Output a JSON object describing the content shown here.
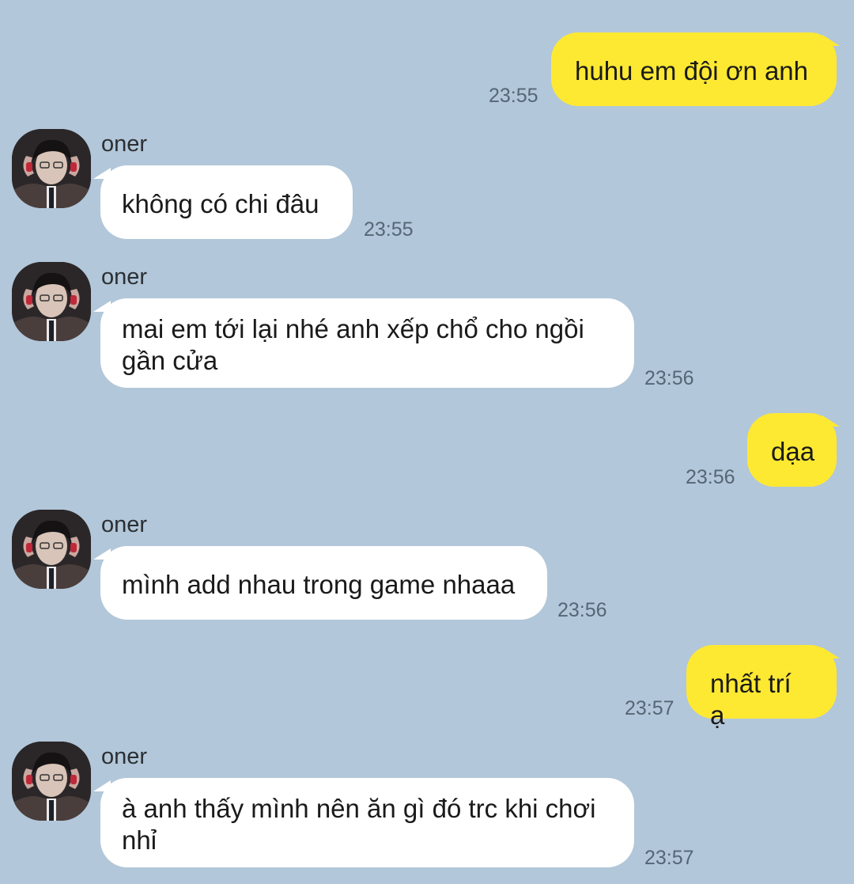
{
  "colors": {
    "background": "#b2c7d9",
    "outgoing_bubble": "#fee932",
    "incoming_bubble": "#ffffff",
    "timestamp": "#556676"
  },
  "messages": [
    {
      "direction": "out",
      "text": "huhu em đội ơn anh",
      "time": "23:55"
    },
    {
      "direction": "in",
      "sender": "oner",
      "avatar": "profile-photo",
      "text": "không có chi đâu",
      "time": "23:55"
    },
    {
      "direction": "in",
      "sender": "oner",
      "avatar": "profile-photo",
      "text": "mai em tới lại nhé anh xếp chổ cho ngồi\ngần cửa",
      "time": "23:56"
    },
    {
      "direction": "out",
      "text": "dạa",
      "time": "23:56"
    },
    {
      "direction": "in",
      "sender": "oner",
      "avatar": "profile-photo",
      "text": "mình add nhau trong game nhaaa",
      "time": "23:56"
    },
    {
      "direction": "out",
      "text": "nhất trí ạ",
      "time": "23:57"
    },
    {
      "direction": "in",
      "sender": "oner",
      "avatar": "profile-photo",
      "text": "à anh thấy mình nên ăn gì đó trc khi chơi\nnhỉ",
      "time": "23:57"
    }
  ]
}
